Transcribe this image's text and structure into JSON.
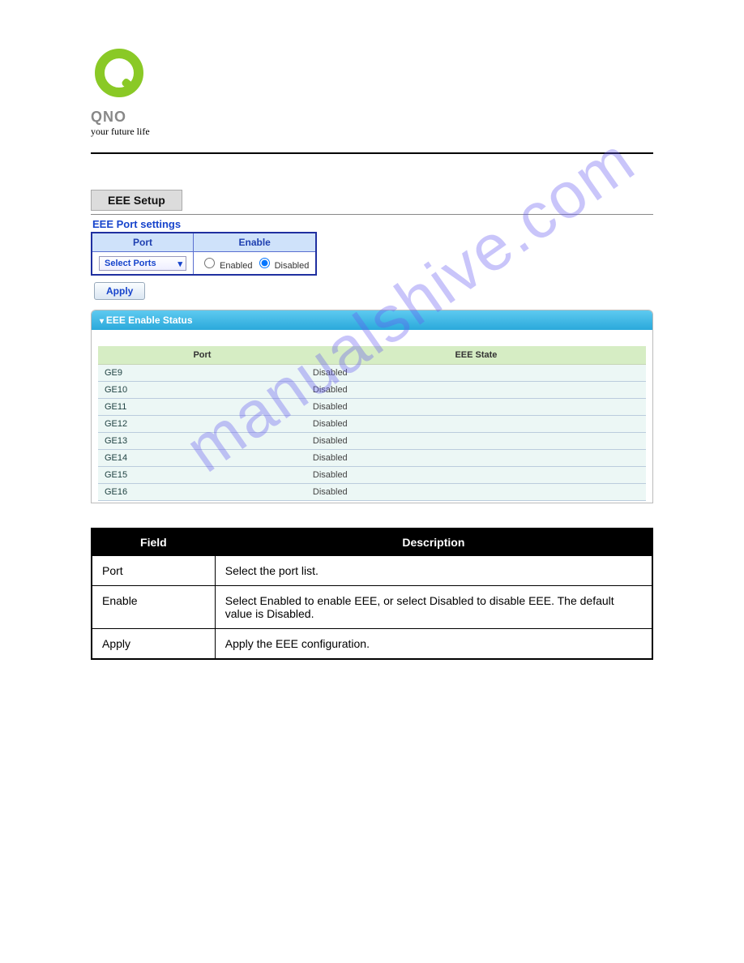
{
  "logo": {
    "brand": "QNO",
    "tagline": "your future life"
  },
  "watermark": "manualshive.com",
  "screenshot": {
    "setup_title": "EEE Setup",
    "port_settings_title": "EEE Port settings",
    "col_port": "Port",
    "col_enable": "Enable",
    "select_ports_label": "Select Ports",
    "enabled_label": "Enabled",
    "disabled_label": "Disabled",
    "apply_label": "Apply",
    "status_panel_title": "EEE Enable Status",
    "status_col_port": "Port",
    "status_col_state": "EEE State",
    "status_rows": [
      {
        "port": "GE9",
        "state": "Disabled"
      },
      {
        "port": "GE10",
        "state": "Disabled"
      },
      {
        "port": "GE11",
        "state": "Disabled"
      },
      {
        "port": "GE12",
        "state": "Disabled"
      },
      {
        "port": "GE13",
        "state": "Disabled"
      },
      {
        "port": "GE14",
        "state": "Disabled"
      },
      {
        "port": "GE15",
        "state": "Disabled"
      },
      {
        "port": "GE16",
        "state": "Disabled"
      }
    ]
  },
  "desc_table": {
    "head_field": "Field",
    "head_desc": "Description",
    "rows": [
      {
        "field": "Port",
        "desc": "Select the port list."
      },
      {
        "field": "Enable",
        "desc": "Select Enabled to enable EEE, or select Disabled to disable EEE. The default value is Disabled."
      },
      {
        "field": "Apply",
        "desc": "Apply the EEE configuration."
      }
    ]
  }
}
